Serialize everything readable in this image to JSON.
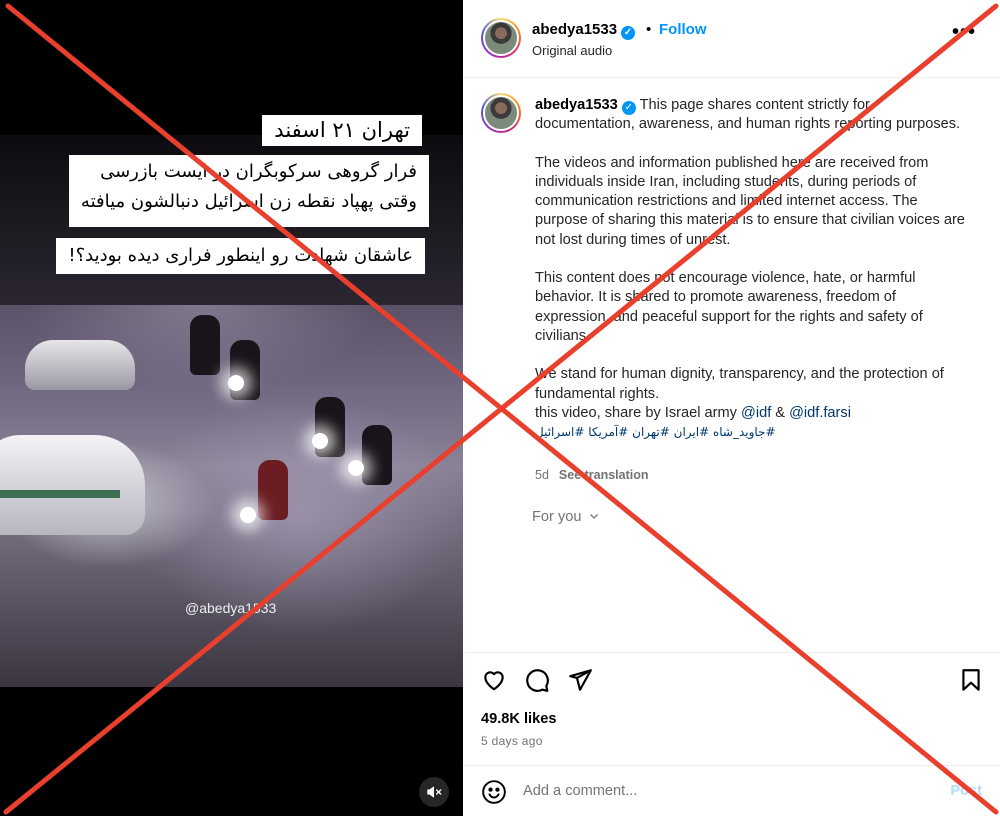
{
  "media": {
    "caption_line1": "تهران ۲۱ اسفند",
    "caption_line2a": "فرار گروهی سرکوبگران در ایست بازرسی",
    "caption_line2b": "وقتی پهپاد نقطه زن اسرائیل دنبالشون میافته",
    "caption_line3": "عاشقان شهادت رو اینطور فراری دیده بودید؟!",
    "watermark": "@abedya1533",
    "mute_icon": "speaker-muted-icon"
  },
  "header": {
    "username": "abedya1533",
    "separator": "•",
    "follow_label": "Follow",
    "audio": "Original audio",
    "more": "•••"
  },
  "caption": {
    "username": "abedya1533",
    "p1": "This page shares content strictly for documentation, awareness, and human rights reporting purposes.",
    "p2": "The videos and information published here are received from individuals inside Iran, including students, during periods of communication restrictions and limited internet access. The purpose of sharing this material is to ensure that civilian voices are not lost during times of unrest.",
    "p3": "This content does not encourage violence, hate, or harmful behavior. It is shared to promote awareness, freedom of expression, and peaceful support for the rights and safety of civilians.",
    "p4": "We stand for human dignity, transparency, and the protection of fundamental rights.",
    "p5_text": "this video, share by Israel army ",
    "mention1": "@idf",
    "amp": " & ",
    "mention2": "@idf.farsi",
    "hashtags": "#جاوید_شاه #ایران #تهران #آمریکا #اسرائیل",
    "age": "5d",
    "see_translation": "See translation"
  },
  "for_you": "For you",
  "actions": {
    "like_icon": "heart-icon",
    "comment_icon": "comment-icon",
    "share_icon": "share-icon",
    "save_icon": "bookmark-icon"
  },
  "likes": "49.8K likes",
  "posted_ago": "5 days ago",
  "comment": {
    "placeholder": "Add a comment...",
    "post_label": "Post"
  },
  "colors": {
    "accent": "#0095f6",
    "cross": "#e8402c"
  }
}
